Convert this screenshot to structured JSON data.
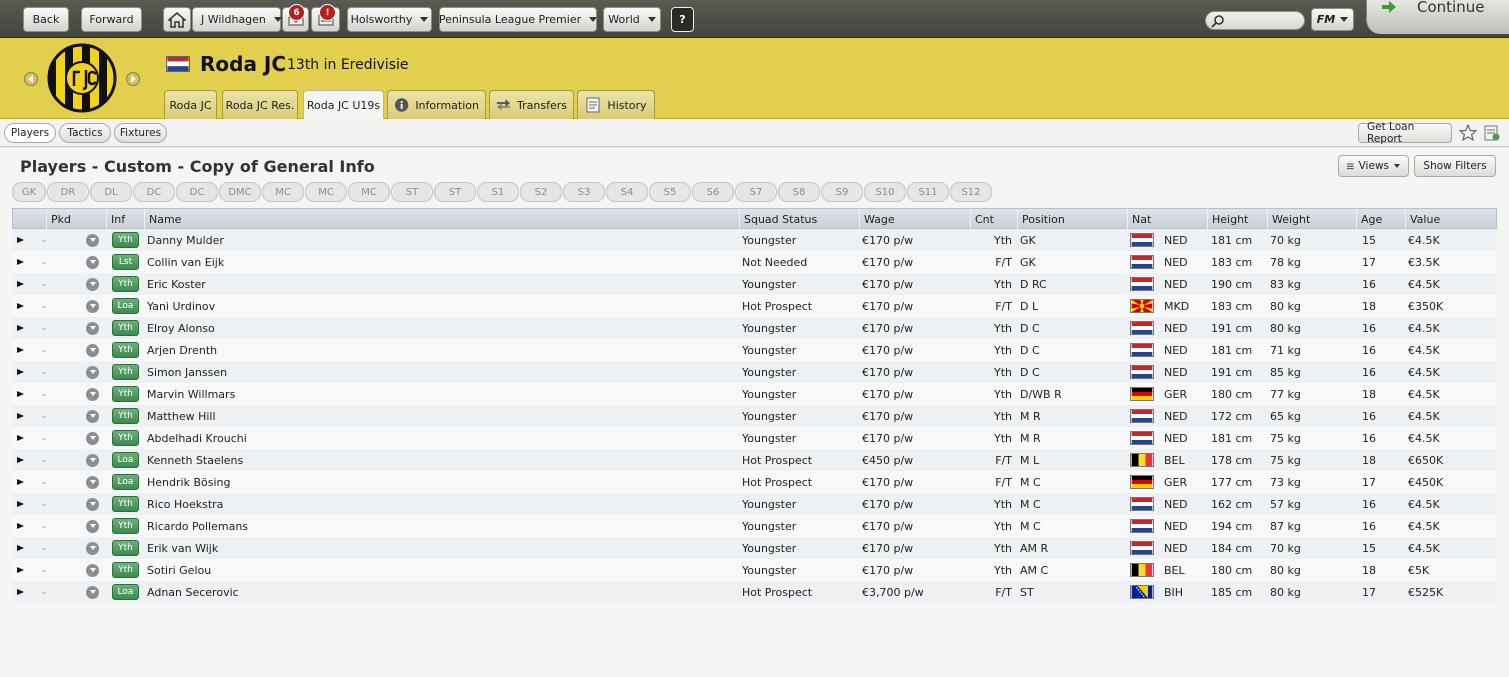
{
  "nav": {
    "back": "Back",
    "forward": "Forward",
    "manager": "J Wildhagen",
    "inbox_count": "6",
    "alert_badge": "!",
    "club_select": "Holsworthy",
    "league_select": "Peninsula League Premier",
    "world_select": "World",
    "help": "?",
    "search_placeholder": "",
    "fm_menu": "FM",
    "continue": "Continue"
  },
  "club": {
    "name": "Roda JC",
    "standing": "13th in Eredivisie",
    "tabs": [
      "Roda JC",
      "Roda JC Res.",
      "Roda JC U19s",
      "Information",
      "Transfers",
      "History"
    ]
  },
  "subnav": {
    "players": "Players",
    "tactics": "Tactics",
    "fixtures": "Fixtures",
    "loan_report": "Get Loan Report"
  },
  "panel": {
    "title": "Players - Custom - Copy of General Info",
    "views": "Views",
    "show_filters": "Show Filters",
    "positions": [
      "GK",
      "DR",
      "DL",
      "DC",
      "DC",
      "DMC",
      "MC",
      "MC",
      "MC",
      "ST",
      "ST",
      "S1",
      "S2",
      "S3",
      "S4",
      "S5",
      "S6",
      "S7",
      "S8",
      "S9",
      "S10",
      "S11",
      "S12"
    ]
  },
  "table": {
    "headers": {
      "pkd": "Pkd",
      "inf": "Inf",
      "name": "Name",
      "squad_status": "Squad Status",
      "wage": "Wage",
      "cnt": "Cnt",
      "position": "Position",
      "nat": "Nat",
      "height": "Height",
      "weight": "Weight",
      "age": "Age",
      "value": "Value"
    },
    "rows": [
      {
        "pkd": "-",
        "inf": "Yth",
        "name": "Danny Mulder",
        "status": "Youngster",
        "wage": "€170 p/w",
        "cnt": "Yth",
        "pos": "GK",
        "nat": "NED",
        "height": "181 cm",
        "weight": "70 kg",
        "age": "15",
        "value": "€4.5K"
      },
      {
        "pkd": "-",
        "inf": "Lst",
        "name": "Collin van Eijk",
        "status": "Not Needed",
        "wage": "€170 p/w",
        "cnt": "F/T",
        "pos": "GK",
        "nat": "NED",
        "height": "183 cm",
        "weight": "78 kg",
        "age": "17",
        "value": "€3.5K"
      },
      {
        "pkd": "-",
        "inf": "Yth",
        "name": "Eric Koster",
        "status": "Youngster",
        "wage": "€170 p/w",
        "cnt": "Yth",
        "pos": "D RC",
        "nat": "NED",
        "height": "190 cm",
        "weight": "83 kg",
        "age": "16",
        "value": "€4.5K"
      },
      {
        "pkd": "-",
        "inf": "Loa",
        "name": "Yani Urdinov",
        "status": "Hot Prospect",
        "wage": "€170 p/w",
        "cnt": "F/T",
        "pos": "D L",
        "nat": "MKD",
        "height": "183 cm",
        "weight": "80 kg",
        "age": "18",
        "value": "€350K"
      },
      {
        "pkd": "-",
        "inf": "Yth",
        "name": "Elroy Alonso",
        "status": "Youngster",
        "wage": "€170 p/w",
        "cnt": "Yth",
        "pos": "D C",
        "nat": "NED",
        "height": "191 cm",
        "weight": "80 kg",
        "age": "16",
        "value": "€4.5K"
      },
      {
        "pkd": "-",
        "inf": "Yth",
        "name": "Arjen Drenth",
        "status": "Youngster",
        "wage": "€170 p/w",
        "cnt": "Yth",
        "pos": "D C",
        "nat": "NED",
        "height": "181 cm",
        "weight": "71 kg",
        "age": "16",
        "value": "€4.5K"
      },
      {
        "pkd": "-",
        "inf": "Yth",
        "name": "Simon Janssen",
        "status": "Youngster",
        "wage": "€170 p/w",
        "cnt": "Yth",
        "pos": "D C",
        "nat": "NED",
        "height": "191 cm",
        "weight": "85 kg",
        "age": "16",
        "value": "€4.5K"
      },
      {
        "pkd": "-",
        "inf": "Yth",
        "name": "Marvin Willmars",
        "status": "Youngster",
        "wage": "€170 p/w",
        "cnt": "Yth",
        "pos": "D/WB R",
        "nat": "GER",
        "height": "180 cm",
        "weight": "77 kg",
        "age": "18",
        "value": "€4.5K"
      },
      {
        "pkd": "-",
        "inf": "Yth",
        "name": "Matthew Hill",
        "status": "Youngster",
        "wage": "€170 p/w",
        "cnt": "Yth",
        "pos": "M R",
        "nat": "NED",
        "height": "172 cm",
        "weight": "65 kg",
        "age": "16",
        "value": "€4.5K"
      },
      {
        "pkd": "-",
        "inf": "Yth",
        "name": "Abdelhadi Krouchi",
        "status": "Youngster",
        "wage": "€170 p/w",
        "cnt": "Yth",
        "pos": "M R",
        "nat": "NED",
        "height": "181 cm",
        "weight": "75 kg",
        "age": "16",
        "value": "€4.5K"
      },
      {
        "pkd": "-",
        "inf": "Loa",
        "name": "Kenneth Staelens",
        "status": "Hot Prospect",
        "wage": "€450 p/w",
        "cnt": "F/T",
        "pos": "M L",
        "nat": "BEL",
        "height": "178 cm",
        "weight": "75 kg",
        "age": "18",
        "value": "€650K"
      },
      {
        "pkd": "-",
        "inf": "Loa",
        "name": "Hendrik Bösing",
        "status": "Hot Prospect",
        "wage": "€170 p/w",
        "cnt": "F/T",
        "pos": "M C",
        "nat": "GER",
        "height": "177 cm",
        "weight": "73 kg",
        "age": "17",
        "value": "€450K"
      },
      {
        "pkd": "-",
        "inf": "Yth",
        "name": "Rico Hoekstra",
        "status": "Youngster",
        "wage": "€170 p/w",
        "cnt": "Yth",
        "pos": "M C",
        "nat": "NED",
        "height": "162 cm",
        "weight": "57 kg",
        "age": "16",
        "value": "€4.5K"
      },
      {
        "pkd": "-",
        "inf": "Yth",
        "name": "Ricardo Pollemans",
        "status": "Youngster",
        "wage": "€170 p/w",
        "cnt": "Yth",
        "pos": "M C",
        "nat": "NED",
        "height": "194 cm",
        "weight": "87 kg",
        "age": "16",
        "value": "€4.5K"
      },
      {
        "pkd": "-",
        "inf": "Yth",
        "name": "Erik van Wijk",
        "status": "Youngster",
        "wage": "€170 p/w",
        "cnt": "Yth",
        "pos": "AM R",
        "nat": "NED",
        "height": "184 cm",
        "weight": "70 kg",
        "age": "15",
        "value": "€4.5K"
      },
      {
        "pkd": "-",
        "inf": "Yth",
        "name": "Sotiri Gelou",
        "status": "Youngster",
        "wage": "€170 p/w",
        "cnt": "Yth",
        "pos": "AM C",
        "nat": "BEL",
        "height": "180 cm",
        "weight": "80 kg",
        "age": "18",
        "value": "€5K"
      },
      {
        "pkd": "-",
        "inf": "Loa",
        "name": "Adnan Secerovic",
        "status": "Hot Prospect",
        "wage": "€3,700 p/w",
        "cnt": "F/T",
        "pos": "ST",
        "nat": "BIH",
        "height": "185 cm",
        "weight": "80 kg",
        "age": "17",
        "value": "€525K"
      }
    ]
  },
  "colors": {
    "header_yellow": "#e1cf4d",
    "topbar": "#4f4f47",
    "badge_green": "#4a9a5c",
    "badge_red": "#b41f1f"
  },
  "icons": {
    "home": "home-icon",
    "inbox": "inbox-icon",
    "news": "news-icon",
    "search": "search-icon",
    "continue": "continue-arrow-icon",
    "star": "star-icon",
    "notes": "notes-icon"
  }
}
